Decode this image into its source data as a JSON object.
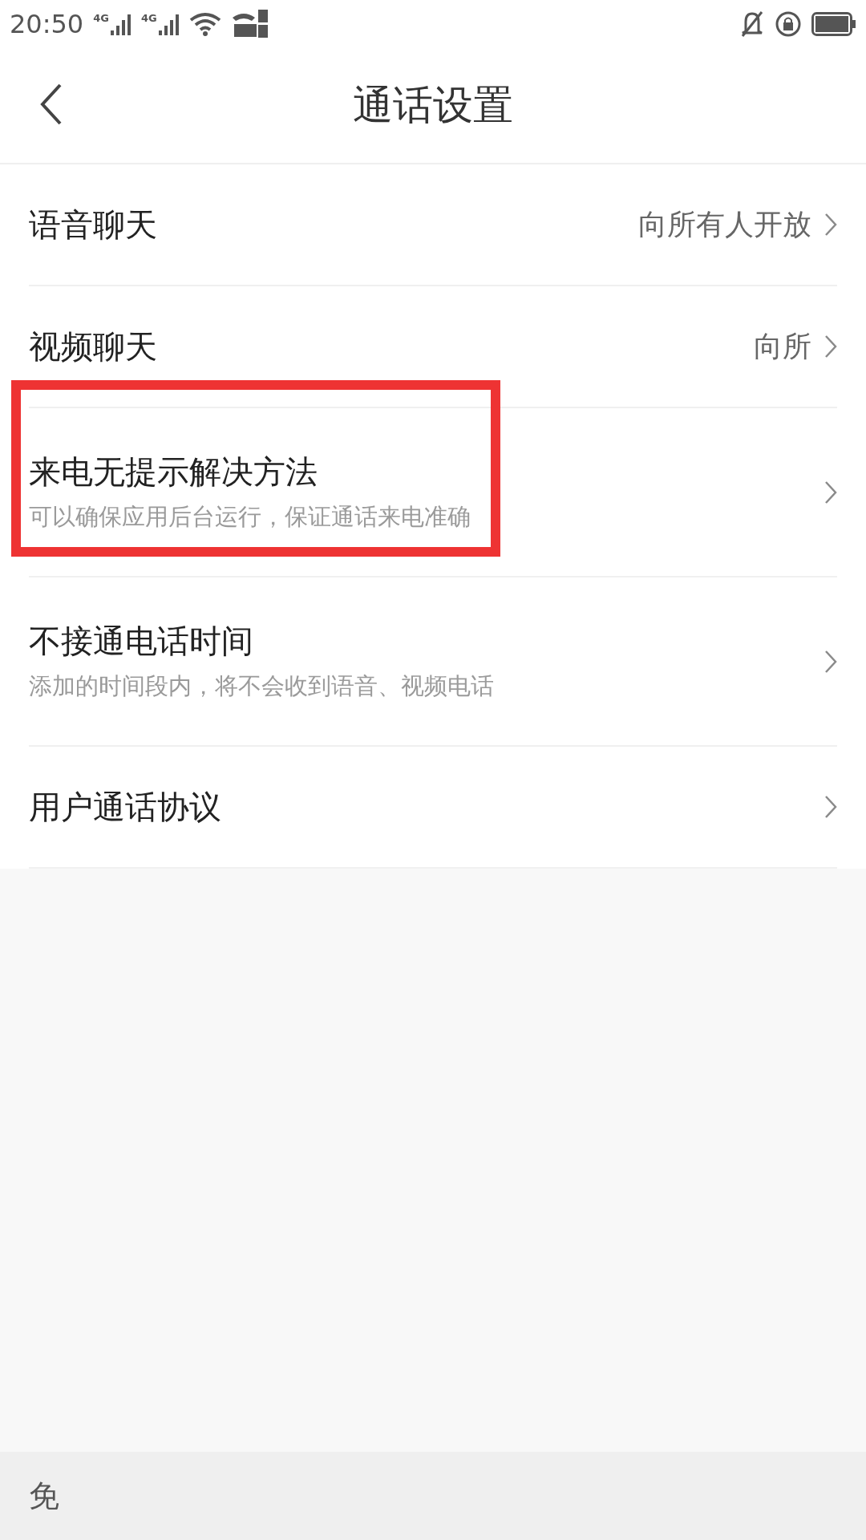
{
  "status_bar": {
    "time": "20:50",
    "signal_labels": [
      "4G",
      "4G"
    ]
  },
  "header": {
    "title": "通话设置"
  },
  "rows": [
    {
      "title": "语音聊天",
      "value": "向所有人开放",
      "highlighted": false
    },
    {
      "title": "视频聊天",
      "value": "向所",
      "highlighted": false
    },
    {
      "title": "来电无提示解决方法",
      "subtitle": "可以确保应用后台运行，保证通话来电准确",
      "highlighted": true
    },
    {
      "title": "不接通电话时间",
      "subtitle": "添加的时间段内，将不会收到语音、视频电话",
      "highlighted": false
    },
    {
      "title": "用户通话协议",
      "highlighted": false
    }
  ],
  "bottom_bar": {
    "text": "免"
  }
}
